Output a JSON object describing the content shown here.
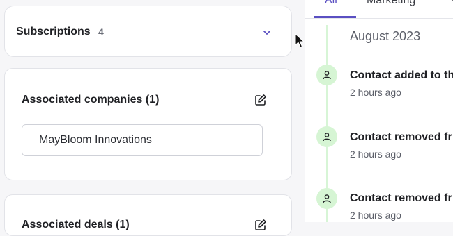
{
  "subscriptions": {
    "title": "Subscriptions",
    "count": "4"
  },
  "associated_companies": {
    "title": "Associated companies (1)",
    "items": [
      "MayBloom Innovations"
    ]
  },
  "associated_deals": {
    "title": "Associated deals (1)"
  },
  "activity": {
    "tabs": [
      "All",
      "Marketing"
    ],
    "month": "August 2023",
    "events": [
      {
        "title": "Contact added to th",
        "time": "2 hours ago"
      },
      {
        "title": "Contact removed fr",
        "time": "2 hours ago"
      },
      {
        "title": "Contact removed fr",
        "time": "2 hours ago"
      }
    ]
  },
  "colors": {
    "accent": "#5a4fc2",
    "timeline": "#d7f5d6",
    "icon_bg": "#d6f5d4"
  },
  "icons": {
    "chevron": "chevron-down-icon",
    "edit": "edit-icon",
    "person": "person-icon",
    "more": "more-icon"
  }
}
